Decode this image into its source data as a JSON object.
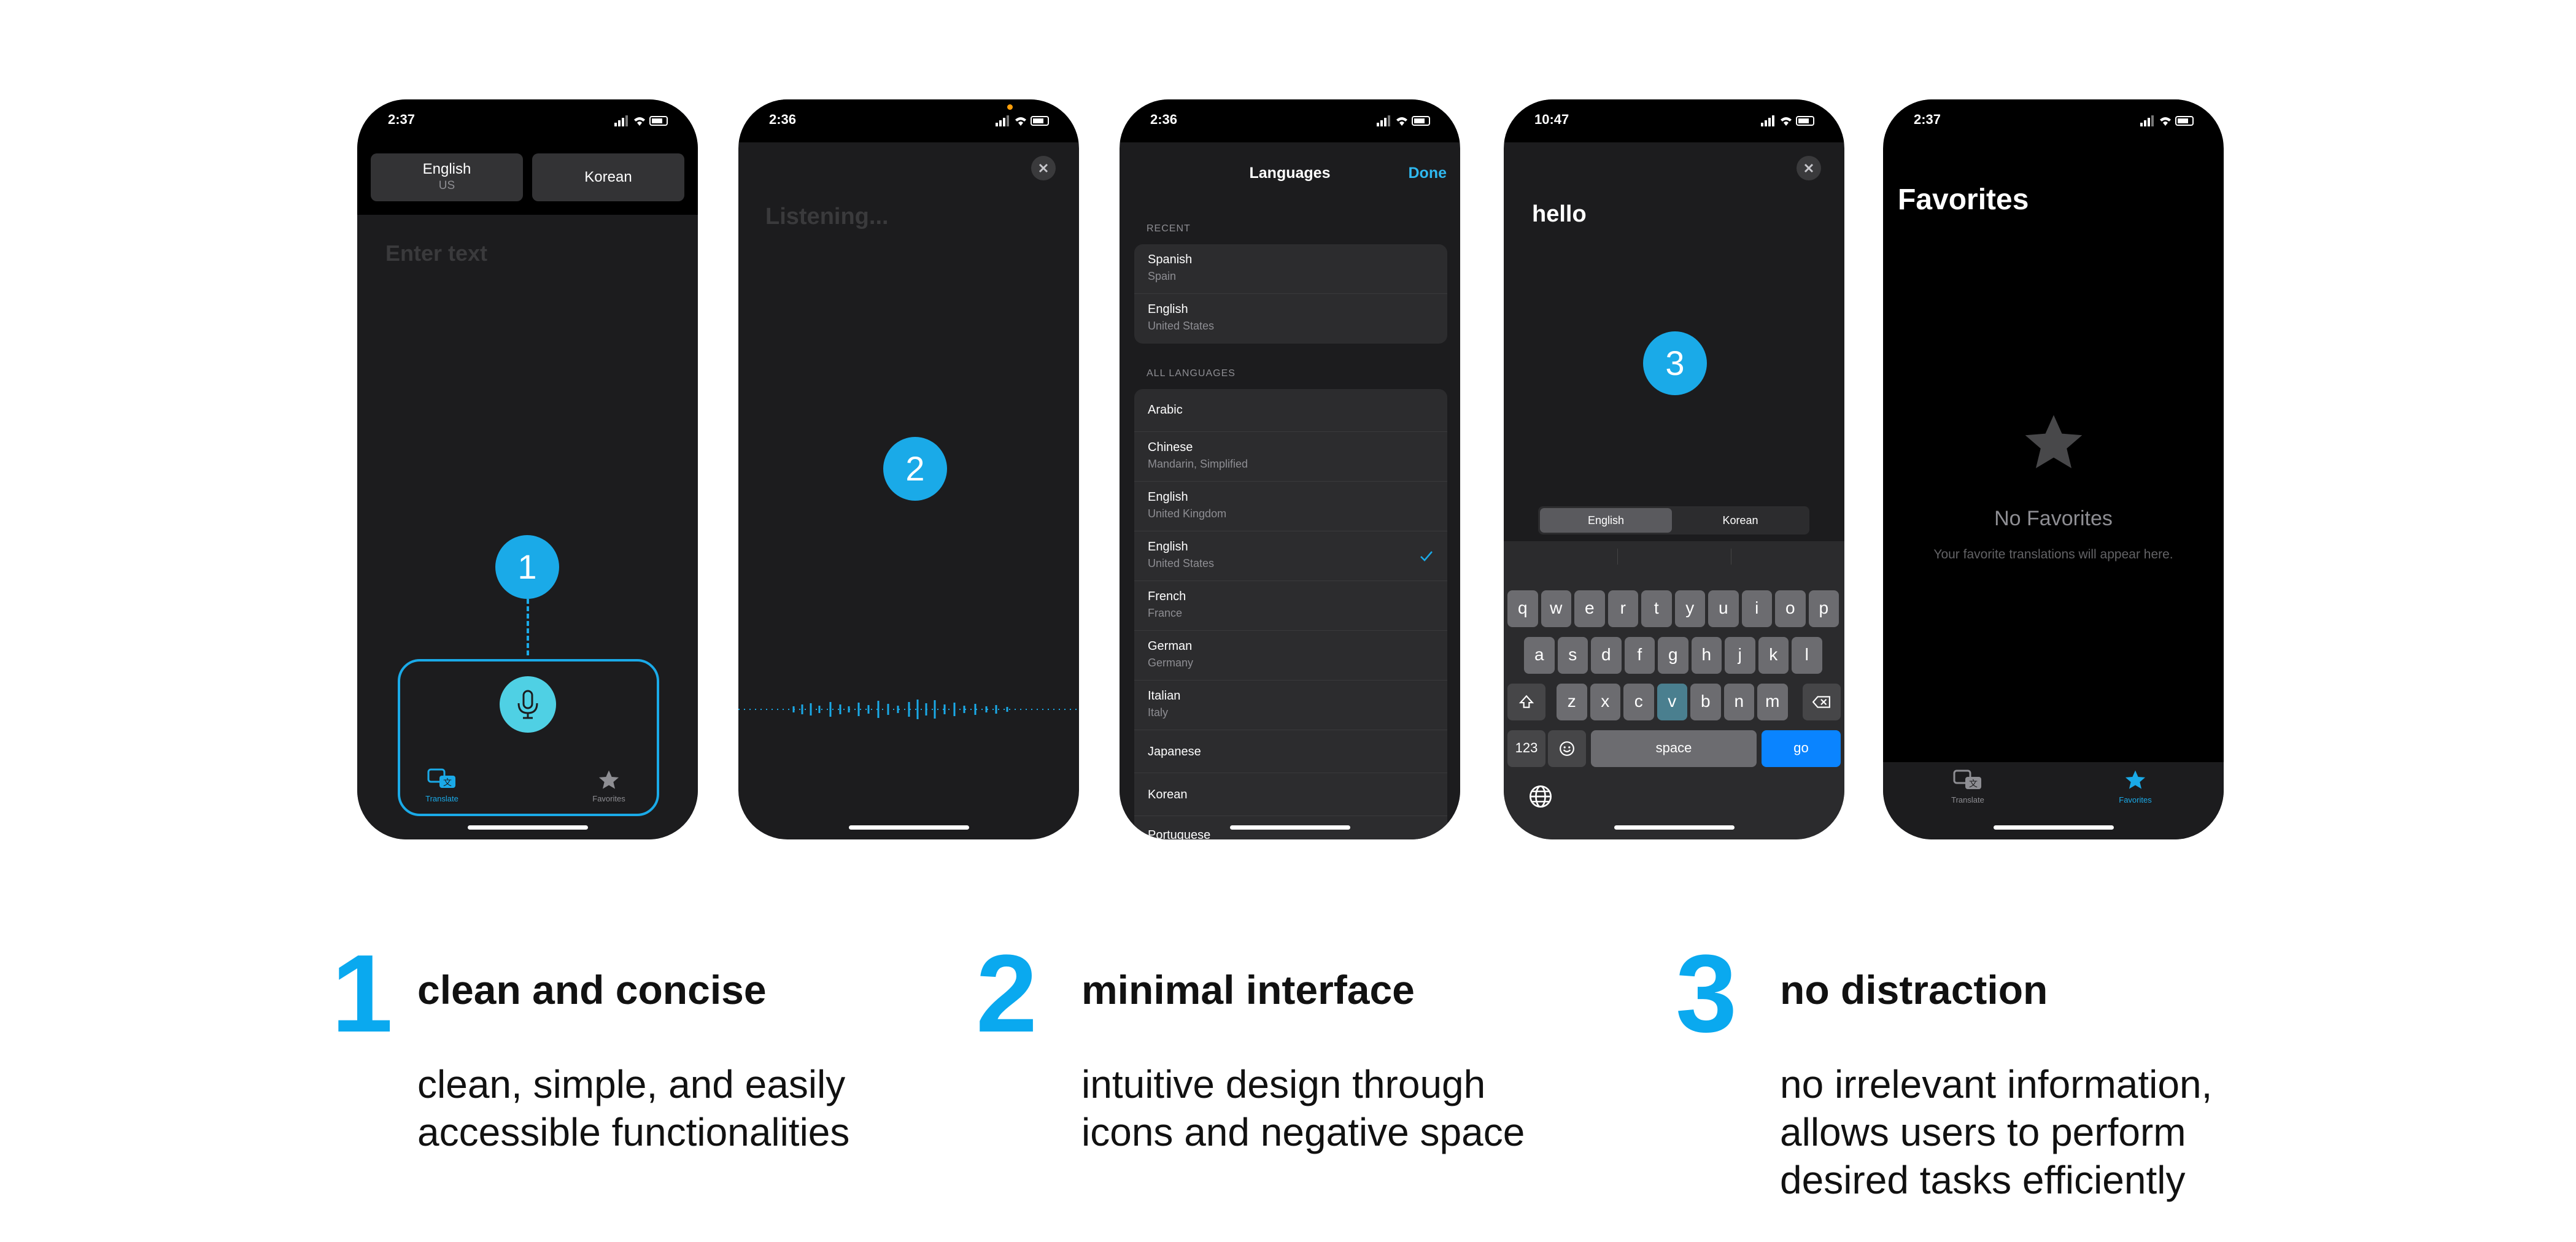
{
  "colors": {
    "accent": "#1aaae8",
    "caption_accent": "#0aa9ef",
    "done": "#2fb8ef",
    "go": "#0a84ff"
  },
  "phone1": {
    "time": "2:37",
    "source_lang": "English",
    "source_region": "US",
    "target_lang": "Korean",
    "placeholder": "Enter text",
    "step": "1",
    "tab_translate": "Translate",
    "tab_favorites": "Favorites"
  },
  "phone2": {
    "time": "2:36",
    "listening": "Listening...",
    "step": "2"
  },
  "phone3": {
    "time": "2:36",
    "title": "Languages",
    "done": "Done",
    "recent_label": "RECENT",
    "all_label": "ALL LANGUAGES",
    "recent": [
      {
        "name": "Spanish",
        "region": "Spain"
      },
      {
        "name": "English",
        "region": "United States"
      }
    ],
    "all": [
      {
        "name": "Arabic",
        "region": ""
      },
      {
        "name": "Chinese",
        "region": "Mandarin, Simplified"
      },
      {
        "name": "English",
        "region": "United Kingdom"
      },
      {
        "name": "English",
        "region": "United States",
        "selected": true
      },
      {
        "name": "French",
        "region": "France"
      },
      {
        "name": "German",
        "region": "Germany"
      },
      {
        "name": "Italian",
        "region": "Italy"
      },
      {
        "name": "Japanese",
        "region": ""
      },
      {
        "name": "Korean",
        "region": ""
      },
      {
        "name": "Portuguese",
        "region": ""
      }
    ]
  },
  "phone4": {
    "time": "10:47",
    "text": "hello",
    "step": "3",
    "seg_left": "English",
    "seg_right": "Korean",
    "row1": [
      "q",
      "w",
      "e",
      "r",
      "t",
      "y",
      "u",
      "i",
      "o",
      "p"
    ],
    "row2": [
      "a",
      "s",
      "d",
      "f",
      "g",
      "h",
      "j",
      "k",
      "l"
    ],
    "row3": [
      "z",
      "x",
      "c",
      "v",
      "b",
      "n",
      "m"
    ],
    "key_123": "123",
    "key_space": "space",
    "key_go": "go"
  },
  "phone5": {
    "time": "2:37",
    "title": "Favorites",
    "empty_title": "No Favorites",
    "empty_sub": "Your favorite translations will appear here.",
    "tab_translate": "Translate",
    "tab_favorites": "Favorites"
  },
  "captions": [
    {
      "num": "1",
      "title": "clean and concise",
      "line1": "clean, simple, and easily",
      "line2": "accessible functionalities",
      "line3": ""
    },
    {
      "num": "2",
      "title": "minimal interface",
      "line1": "intuitive design through",
      "line2": "icons and negative space",
      "line3": ""
    },
    {
      "num": "3",
      "title": "no distraction",
      "line1": "no irrelevant information,",
      "line2": "allows users to perform",
      "line3": "desired tasks efficiently"
    }
  ]
}
